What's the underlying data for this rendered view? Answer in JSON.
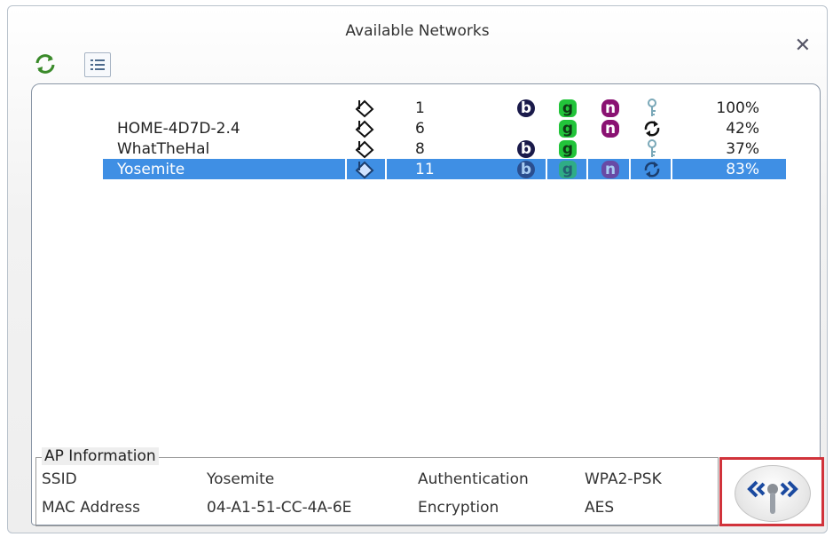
{
  "window": {
    "title": "Available Networks"
  },
  "toolbar": {
    "refresh_icon": "refresh-icon",
    "list_icon": "list-view-icon",
    "close_icon": "close-icon"
  },
  "networks": [
    {
      "ssid": "",
      "channel": "1",
      "b": "b",
      "g": "g",
      "n": "n",
      "security": "key",
      "signal": "100%",
      "selected": false
    },
    {
      "ssid": "HOME-4D7D-2.4",
      "channel": "6",
      "b": "",
      "g": "g",
      "n": "n",
      "security": "refresh",
      "signal": "42%",
      "selected": false
    },
    {
      "ssid": "WhatTheHal",
      "channel": "8",
      "b": "b",
      "g": "g",
      "n": "",
      "security": "key",
      "signal": "37%",
      "selected": false
    },
    {
      "ssid": "Yosemite",
      "channel": "11",
      "b": "b",
      "g": "g",
      "n": "n",
      "security": "refresh",
      "signal": "83%",
      "selected": true
    }
  ],
  "ap_info": {
    "legend": "AP Information",
    "ssid_label": "SSID",
    "ssid_value": "Yosemite",
    "auth_label": "Authentication",
    "auth_value": "WPA2-PSK",
    "mac_label": "MAC Address",
    "mac_value": "04-A1-51-CC-4A-6E",
    "enc_label": "Encryption",
    "enc_value": "AES"
  },
  "colors": {
    "selection": "#3f8fe4",
    "highlight_border": "#d1333b",
    "badge_b": "#1a1a4a",
    "badge_g": "#22c43a",
    "badge_n": "#8a1272"
  }
}
